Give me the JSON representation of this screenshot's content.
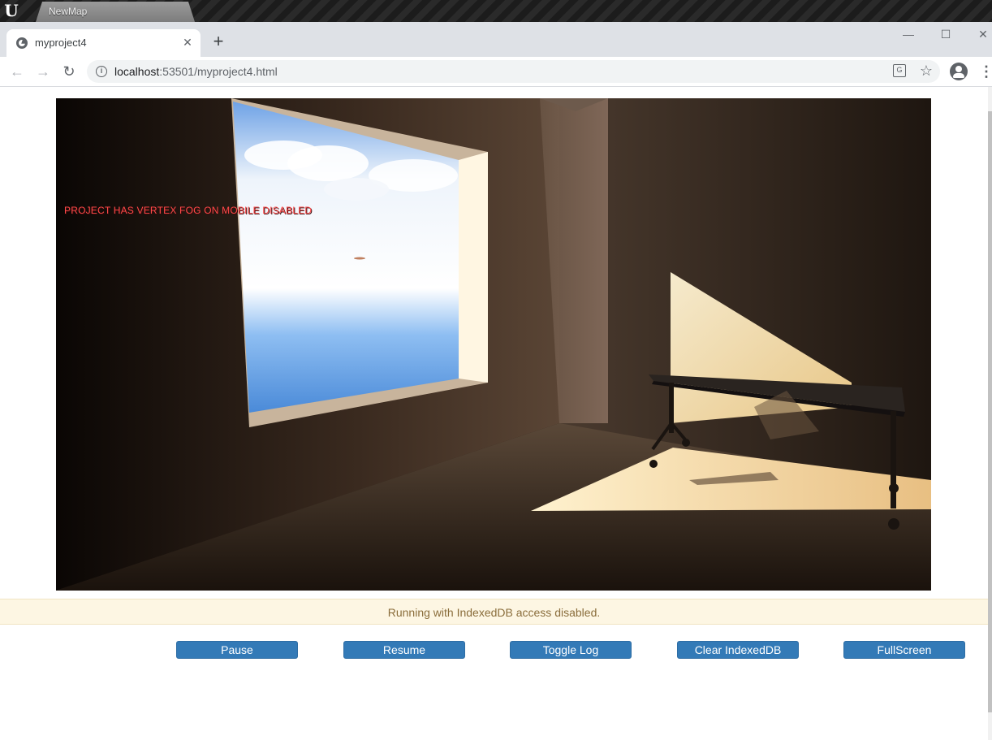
{
  "editor": {
    "logo": "U",
    "tab_label": "NewMap"
  },
  "browser": {
    "tab_title": "myproject4",
    "tab_close": "✕",
    "new_tab": "+",
    "window_controls": {
      "minimize": "—",
      "maximize": "☐",
      "close": "✕"
    },
    "nav": {
      "back": "←",
      "forward": "→",
      "reload": "↻"
    },
    "url_host": "localhost",
    "url_path": ":53501/myproject4.html",
    "info_icon": "i",
    "translate_icon": "G",
    "star_icon": "☆",
    "menu_icon": "⋮"
  },
  "game": {
    "overlay_message": "PROJECT HAS VERTEX FOG ON MOBILE DISABLED",
    "colors": {
      "warning_text": "#ff4a4a",
      "sunlight": "#ffe8b0",
      "sky": "#7ab4f0"
    }
  },
  "status": {
    "message": "Running with IndexedDB access disabled."
  },
  "controls": {
    "pause": "Pause",
    "resume": "Resume",
    "toggle_log": "Toggle Log",
    "clear_indexeddb": "Clear IndexedDB",
    "fullscreen": "FullScreen"
  }
}
